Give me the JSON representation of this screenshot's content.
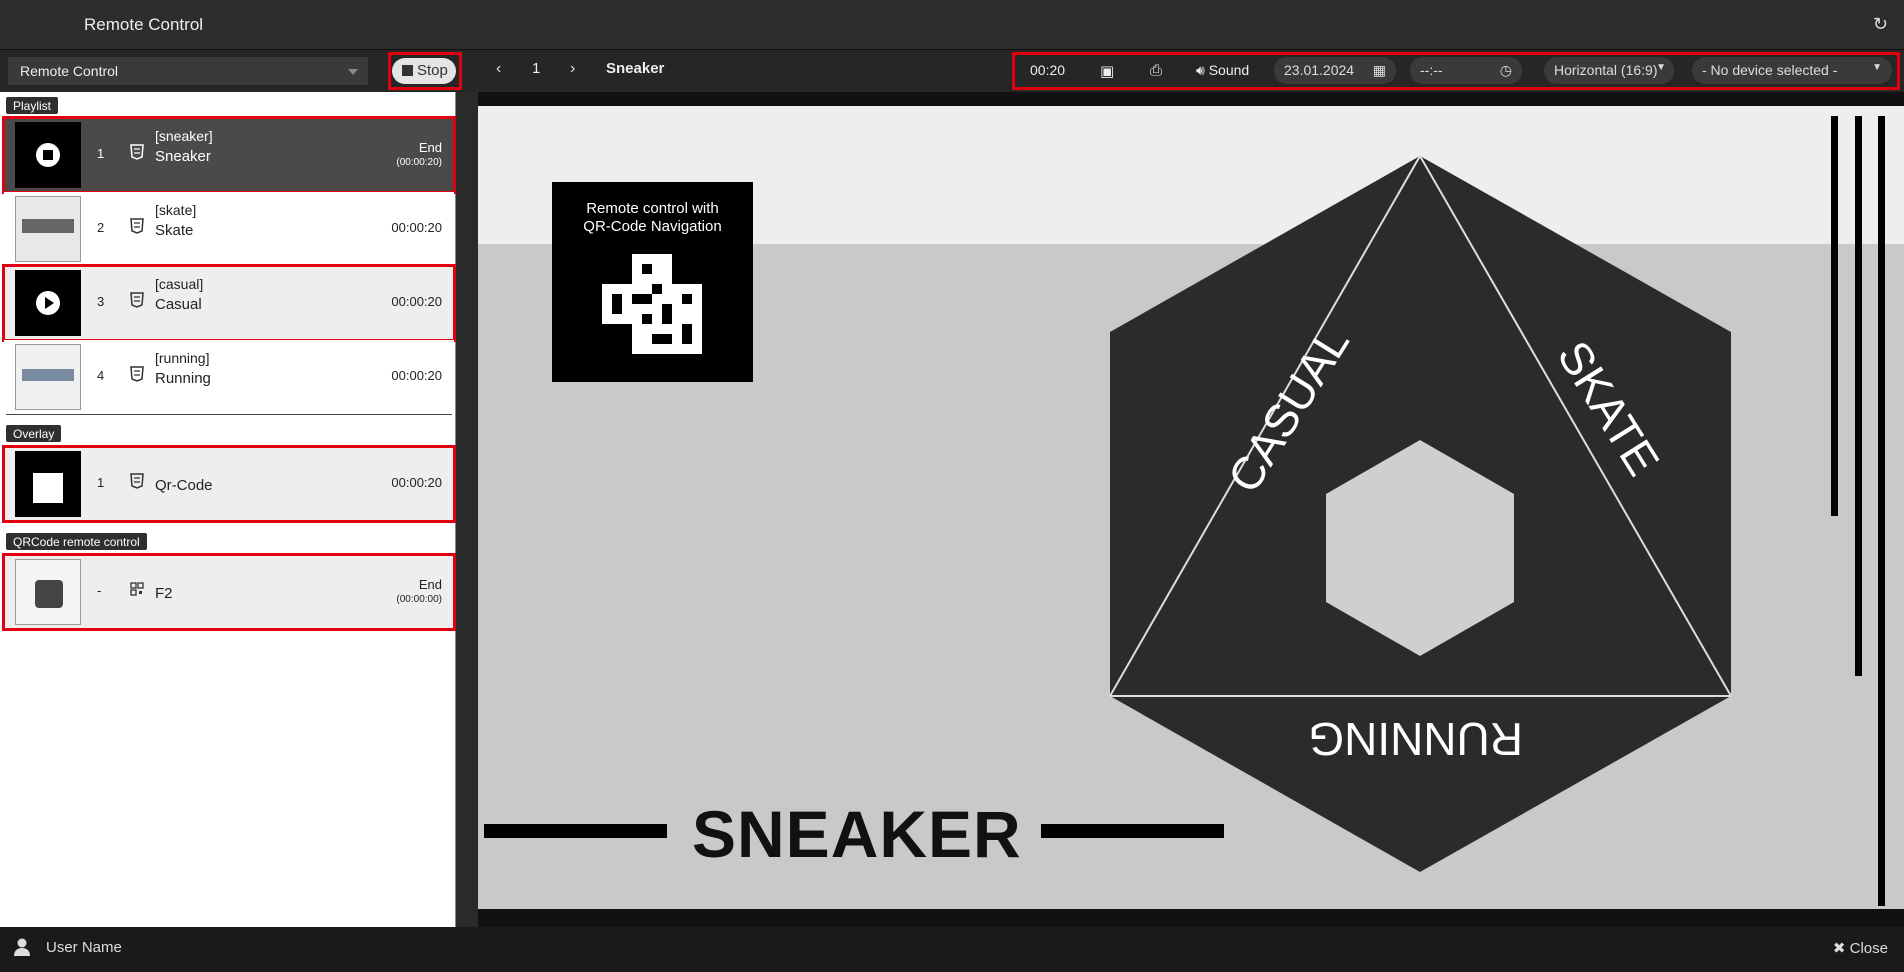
{
  "window": {
    "title": "Remote Control"
  },
  "toolbar": {
    "select_value": "Remote Control",
    "stop_label": "Stop",
    "page_number": "1",
    "current_title": "Sneaker",
    "timer": "00:20",
    "sound_label": "Sound",
    "date_value": "23.01.2024",
    "time_value": "--:--",
    "orientation_value": "Horizontal (16:9)",
    "device_value": "- No device selected -"
  },
  "playlist": {
    "label": "Playlist",
    "items": [
      {
        "num": "1",
        "tag": "[sneaker]",
        "name": "Sneaker",
        "end_label": "End",
        "end_time": "(00:00:20)"
      },
      {
        "num": "2",
        "tag": "[skate]",
        "name": "Skate",
        "duration": "00:00:20"
      },
      {
        "num": "3",
        "tag": "[casual]",
        "name": "Casual",
        "duration": "00:00:20"
      },
      {
        "num": "4",
        "tag": "[running]",
        "name": "Running",
        "duration": "00:00:20"
      }
    ]
  },
  "overlay": {
    "label": "Overlay",
    "items": [
      {
        "num": "1",
        "name": "Qr-Code",
        "duration": "00:00:20"
      }
    ]
  },
  "qrcode": {
    "label": "QRCode remote control",
    "items": [
      {
        "num": "-",
        "name": "F2",
        "end_label": "End",
        "end_time": "(00:00:00)"
      }
    ]
  },
  "preview": {
    "qr_text_line1": "Remote control with",
    "qr_text_line2": "QR-Code Navigation",
    "casual": "CASUAL",
    "skate": "SKATE",
    "running": "RUNNING",
    "sneaker": "SNEAKER"
  },
  "footer": {
    "user_name": "User Name",
    "close_label": "Close"
  },
  "colors": {
    "highlight": "#e00010",
    "active_row": "#4a4a4a"
  },
  "icons": [
    "refresh-icon",
    "stop-icon",
    "chevron-left-icon",
    "chevron-right-icon",
    "camera-icon",
    "print-icon",
    "sound-icon",
    "calendar-icon",
    "clock-icon",
    "html5-icon",
    "qr-icon",
    "user-icon",
    "close-icon"
  ]
}
